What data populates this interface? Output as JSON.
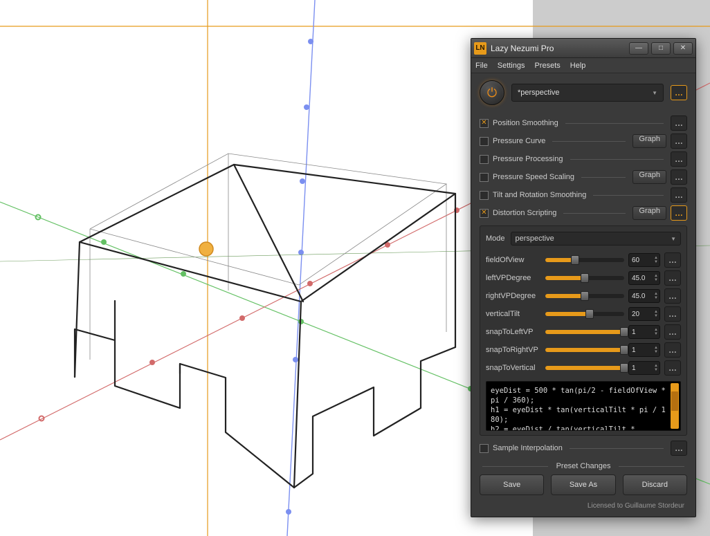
{
  "app": {
    "icon_text": "LN",
    "title": "Lazy Nezumi Pro"
  },
  "menu": [
    "File",
    "Settings",
    "Presets",
    "Help"
  ],
  "preset": {
    "current": "*perspective"
  },
  "sections": {
    "position_smoothing": {
      "label": "Position Smoothing",
      "checked": true,
      "graph": false
    },
    "pressure_curve": {
      "label": "Pressure Curve",
      "checked": false,
      "graph": true
    },
    "pressure_processing": {
      "label": "Pressure Processing",
      "checked": false,
      "graph": false
    },
    "pressure_speed_scaling": {
      "label": "Pressure Speed Scaling",
      "checked": false,
      "graph": true
    },
    "tilt_rotation": {
      "label": "Tilt and Rotation Smoothing",
      "checked": false,
      "graph": false
    },
    "distortion_scripting": {
      "label": "Distortion Scripting",
      "checked": true,
      "graph": true,
      "highlight": true
    },
    "sample_interpolation": {
      "label": "Sample Interpolation",
      "checked": false,
      "graph": false
    }
  },
  "distortion": {
    "mode_label": "Mode",
    "mode_value": "perspective",
    "params": [
      {
        "name": "fieldOfView",
        "value": "60",
        "pct": 38
      },
      {
        "name": "leftVPDegree",
        "value": "45.0",
        "pct": 50
      },
      {
        "name": "rightVPDegree",
        "value": "45.0",
        "pct": 50
      },
      {
        "name": "verticalTilt",
        "value": "20",
        "pct": 56
      },
      {
        "name": "snapToLeftVP",
        "value": "1",
        "pct": 100
      },
      {
        "name": "snapToRightVP",
        "value": "1",
        "pct": 100
      },
      {
        "name": "snapToVertical",
        "value": "1",
        "pct": 100
      }
    ],
    "script": "eyeDist = 500 * tan(pi/2 - fieldOfView * pi / 360);\nh1 = eyeDist * tan(verticalTilt * pi / 180);\nh2 = eyeDist / tan(verticalTilt *"
  },
  "buttons": {
    "graph": "Graph",
    "save": "Save",
    "save_as": "Save As",
    "discard": "Discard",
    "preset_changes": "Preset Changes"
  },
  "license": "Licensed to Guillaume Stordeur"
}
